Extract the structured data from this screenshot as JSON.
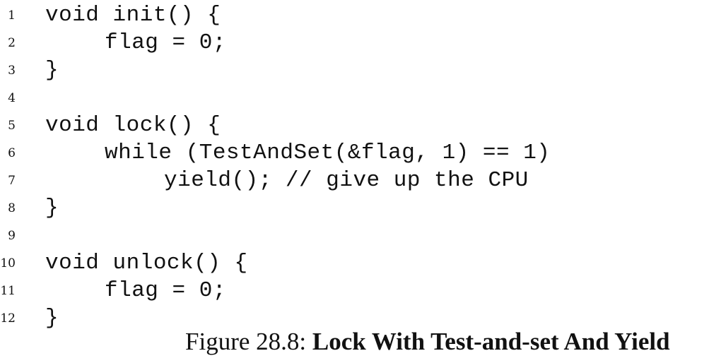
{
  "code": {
    "lines": [
      {
        "num": "1",
        "text": "void init() {",
        "indent": 0
      },
      {
        "num": "2",
        "text": "flag = 0;",
        "indent": 1
      },
      {
        "num": "3",
        "text": "}",
        "indent": 0
      },
      {
        "num": "4",
        "text": "",
        "indent": 0
      },
      {
        "num": "5",
        "text": "void lock() {",
        "indent": 0
      },
      {
        "num": "6",
        "text": "while (TestAndSet(&flag, 1) == 1)",
        "indent": 1
      },
      {
        "num": "7",
        "text": "yield(); // give up the CPU",
        "indent": 2
      },
      {
        "num": "8",
        "text": "}",
        "indent": 0
      },
      {
        "num": "9",
        "text": "",
        "indent": 0
      },
      {
        "num": "10",
        "text": "void unlock() {",
        "indent": 0
      },
      {
        "num": "11",
        "text": "flag = 0;",
        "indent": 1
      },
      {
        "num": "12",
        "text": "}",
        "indent": 0
      }
    ]
  },
  "caption": {
    "label": "Figure 28.8:",
    "title": "Lock With Test-and-set And Yield"
  }
}
